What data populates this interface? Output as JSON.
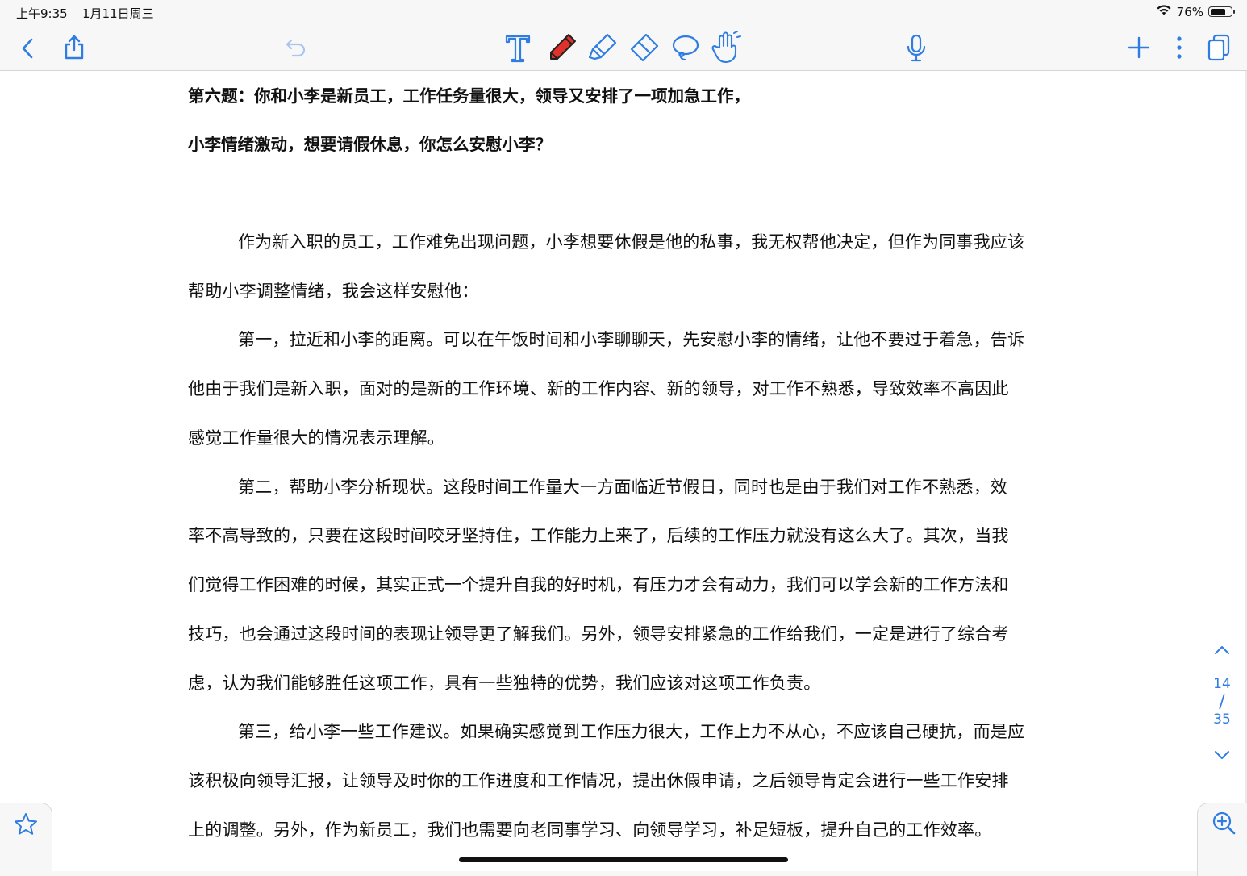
{
  "status_bar": {
    "time": "上午9:35",
    "date": "1月11日周三",
    "battery_percent": "76%",
    "battery_level": 0.76
  },
  "toolbar": {
    "icons": [
      "back-chevron-icon",
      "share-icon",
      "undo-icon",
      "text-tool-icon",
      "pen-tool-icon",
      "highlighter-tool-icon",
      "eraser-tool-icon",
      "lasso-tool-icon",
      "hand-tool-icon",
      "microphone-icon",
      "add-icon",
      "more-icon",
      "pages-icon"
    ],
    "accent_color": "#2f7de1",
    "pen_color": "#e0312b"
  },
  "document": {
    "question_lines": [
      "第六题：你和小李是新员工，工作任务量很大，领导又安排了一项加急工作，",
      "小李情绪激动，想要请假休息，你怎么安慰小李？"
    ],
    "body_lines": [
      "作为新入职的员工，工作难免出现问题，小李想要休假是他的私事，我无权帮他决定，但作为同事我应该",
      "帮助小李调整情绪，我会这样安慰他：",
      "第一，拉近和小李的距离。可以在午饭时间和小李聊聊天，先安慰小李的情绪，让他不要过于着急，告诉",
      "他由于我们是新入职，面对的是新的工作环境、新的工作内容、新的领导，对工作不熟悉，导致效率不高因此",
      "感觉工作量很大的情况表示理解。",
      "第二，帮助小李分析现状。这段时间工作量大一方面临近节假日，同时也是由于我们对工作不熟悉，效",
      "率不高导致的，只要在这段时间咬牙坚持住，工作能力上来了，后续的工作压力就没有这么大了。其次，当我",
      "们觉得工作困难的时候，其实正式一个提升自我的好时机，有压力才会有动力，我们可以学会新的工作方法和",
      "技巧，也会通过这段时间的表现让领导更了解我们。另外，领导安排紧急的工作给我们，一定是进行了综合考",
      "虑，认为我们能够胜任这项工作，具有一些独特的优势，我们应该对这项工作负责。",
      "第三，给小李一些工作建议。如果确实感觉到工作压力很大，工作上力不从心，不应该自己硬抗，而是应",
      "该积极向领导汇报，让领导及时你的工作进度和工作情况，提出休假申请，之后领导肯定会进行一些工作安排",
      "上的调整。另外，作为新员工，我们也需要向老同事学习、向领导学习，补足短板，提升自己的工作效率。"
    ]
  },
  "pager": {
    "current": "14",
    "separator": "/",
    "total": "35"
  },
  "bottom": {
    "left_icon": "star-icon",
    "right_icon": "zoom-in-icon"
  }
}
